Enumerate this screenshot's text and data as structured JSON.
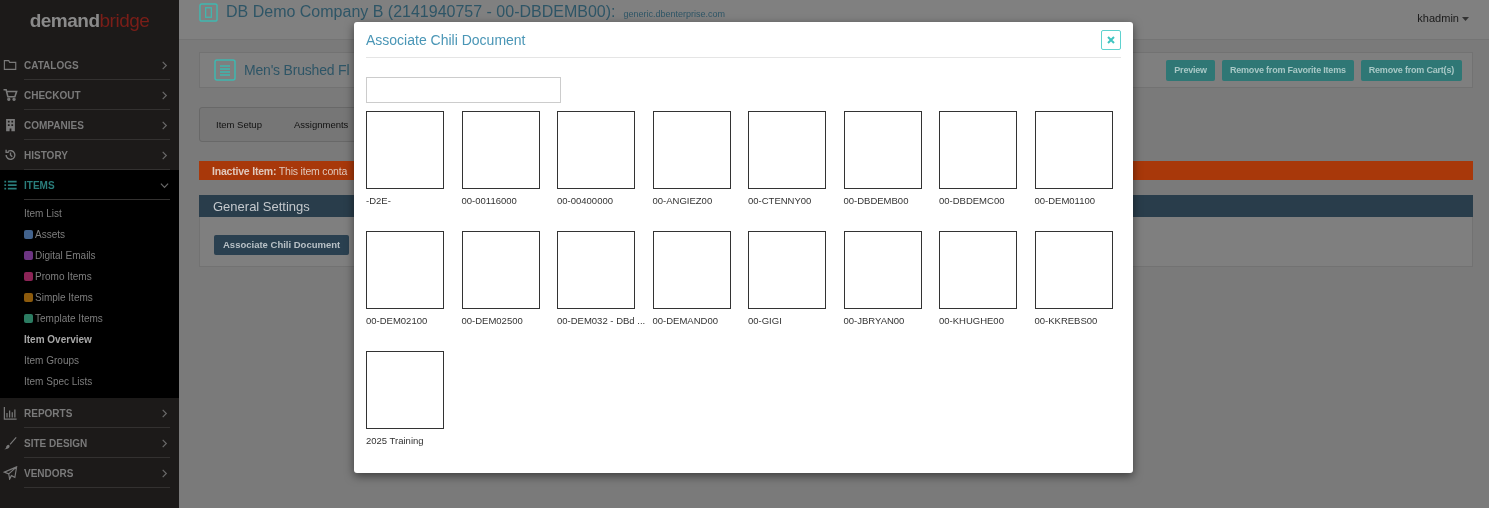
{
  "logo": {
    "first": "demand",
    "second": "bridge"
  },
  "header": {
    "company": "DB Demo Company B (2141940757 - 00-DBDEMB00):",
    "domain": "generic.dbenterprise.com",
    "user": "khadmin"
  },
  "sidebar": {
    "items": [
      {
        "label": "CATALOGS",
        "expanded": false
      },
      {
        "label": "CHECKOUT",
        "expanded": false
      },
      {
        "label": "COMPANIES",
        "expanded": false
      },
      {
        "label": "HISTORY",
        "expanded": false
      },
      {
        "label": "ITEMS",
        "expanded": true,
        "children": [
          {
            "label": "Item List",
            "selected": false
          },
          {
            "label": "Assets",
            "color": "#42628c",
            "selected": false
          },
          {
            "label": "Digital Emails",
            "color": "#6c3482",
            "selected": false
          },
          {
            "label": "Promo Items",
            "color": "#8c2456",
            "selected": false
          },
          {
            "label": "Simple Items",
            "color": "#8c5a0c",
            "selected": false
          },
          {
            "label": "Template Items",
            "color": "#2c7c62",
            "selected": false
          },
          {
            "label": "Item Overview",
            "selected": true
          },
          {
            "label": "Item Groups",
            "selected": false
          },
          {
            "label": "Item Spec Lists",
            "selected": false
          }
        ]
      },
      {
        "label": "REPORTS",
        "expanded": false
      },
      {
        "label": "SITE DESIGN",
        "expanded": false
      },
      {
        "label": "VENDORS",
        "expanded": false
      }
    ]
  },
  "item_card": {
    "title": "Men's Brushed Fl",
    "buttons": [
      "Preview",
      "Remove from Favorite Items",
      "Remove from Cart(s)"
    ]
  },
  "steps": [
    "Item Setup",
    "Assignments"
  ],
  "alert": {
    "text": "**Inactive Item:** This item conta"
  },
  "general_settings": {
    "title": "General Settings",
    "button": "Associate Chili Document"
  },
  "modal": {
    "title": "Associate Chili Document",
    "documents": [
      "-D2E-",
      "00-00116000",
      "00-00400000",
      "00-ANGIEZ00",
      "00-CTENNY00",
      "00-DBDEMB00",
      "00-DBDEMC00",
      "00-DEM01100",
      "00-DEM02100",
      "00-DEM02500",
      "00-DEM032 - DBd ...",
      "00-DEMAND00",
      "00-GIGI",
      "00-JBRYAN00",
      "00-KHUGHE00",
      "00-KKREBS00",
      "2025 Training"
    ]
  }
}
